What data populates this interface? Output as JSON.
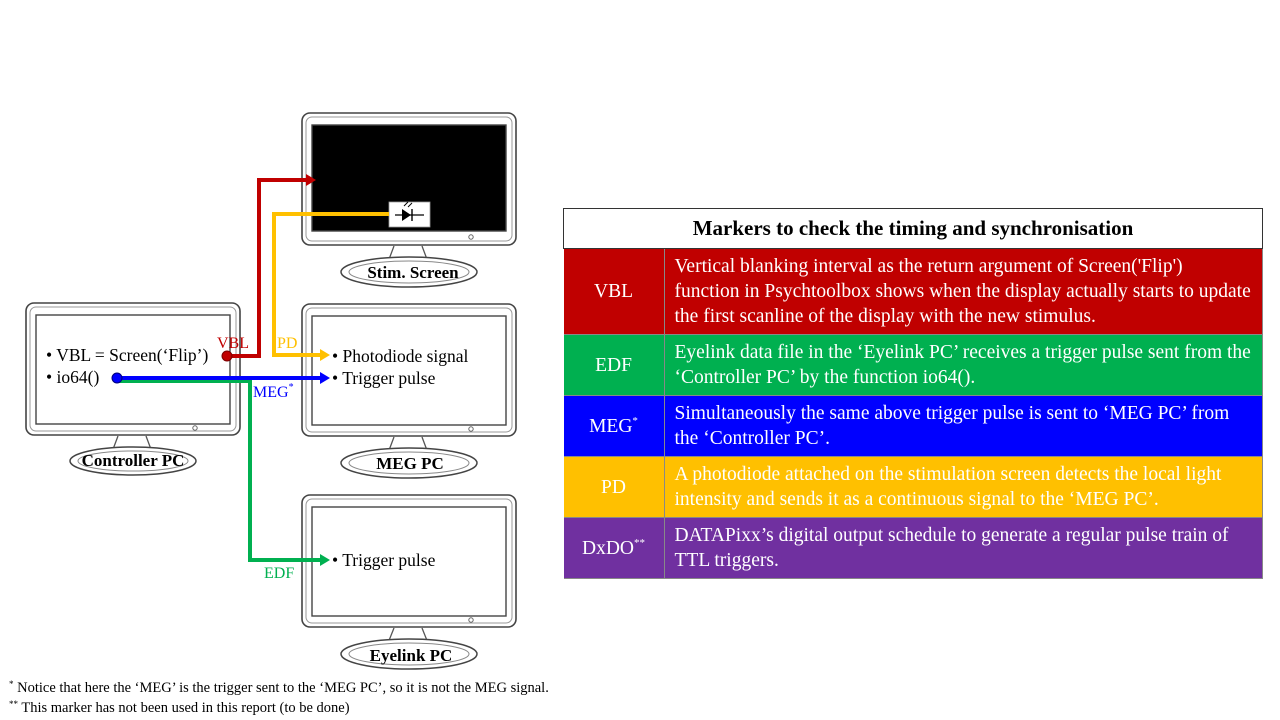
{
  "colors": {
    "vbl": "#c00000",
    "edf": "#00b050",
    "meg": "#0000ff",
    "pd": "#ffc000",
    "dxdo": "#7030a0",
    "screen_black": "#000000"
  },
  "computers": {
    "controller": {
      "label": "Controller PC",
      "lines": [
        "VBL = Screen(‘Flip’)",
        "io64()"
      ]
    },
    "stim": {
      "label": "Stim. Screen"
    },
    "meg": {
      "label": "MEG PC",
      "lines": [
        "Photodiode signal",
        "Trigger pulse"
      ]
    },
    "eyelink": {
      "label": "Eyelink PC",
      "lines": [
        "Trigger pulse"
      ]
    }
  },
  "arrow_labels": {
    "vbl": "VBL",
    "pd": "PD",
    "meg": "MEG",
    "meg_mark": "*",
    "edf": "EDF"
  },
  "icons": {
    "photodiode": "photodiode-icon",
    "power_button": "power-button-icon"
  },
  "table": {
    "title": "Markers to check the timing and synchronisation",
    "rows": [
      {
        "tag": "VBL",
        "mark": "",
        "text": "Vertical blanking interval as the return argument of Screen('Flip') function in Psychtoolbox shows when the display actually starts to update the first scanline of the display with the new stimulus.",
        "color": "#c00000"
      },
      {
        "tag": "EDF",
        "mark": "",
        "text": "Eyelink data file in the ‘Eyelink PC’ receives a trigger pulse sent from the ‘Controller PC’ by the function io64().",
        "color": "#00b050"
      },
      {
        "tag": "MEG",
        "mark": "*",
        "text": "Simultaneously the same above trigger pulse is sent to ‘MEG PC’ from the ‘Controller PC’.",
        "color": "#0000ff"
      },
      {
        "tag": "PD",
        "mark": "",
        "text": "A photodiode attached on the stimulation screen detects the local light intensity and sends it as a continuous signal to the ‘MEG PC’.",
        "color": "#ffc000"
      },
      {
        "tag": "DxDO",
        "mark": "**",
        "text": "DATAPixx’s digital output schedule to generate a regular pulse train of TTL triggers.",
        "color": "#7030a0"
      }
    ]
  },
  "footnotes": [
    {
      "mark": "*",
      "text": "Notice that here the ‘MEG’ is the trigger sent to the ‘MEG PC’, so it is not the MEG signal."
    },
    {
      "mark": "**",
      "text": "This marker has not been used in this report (to be done)"
    }
  ]
}
